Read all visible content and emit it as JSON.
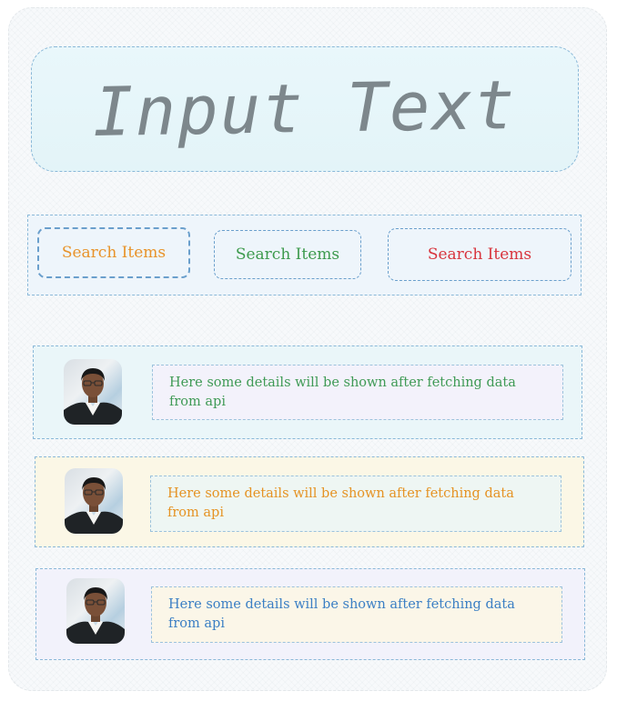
{
  "header": {
    "title": "Input Text"
  },
  "search": {
    "buttons": [
      {
        "label": "Search Items",
        "color": "#e8932a"
      },
      {
        "label": "Search Items",
        "color": "#3d9a4d"
      },
      {
        "label": "Search Items",
        "color": "#d8343d"
      }
    ]
  },
  "items": [
    {
      "details": "Here some details will be shown after fetching data from api",
      "text_color": "#3f9a55"
    },
    {
      "details": "Here some details will be shown after fetching data from api",
      "text_color": "#e59324"
    },
    {
      "details": "Here some details will be shown after fetching data from api",
      "text_color": "#3b7fc4"
    }
  ]
}
